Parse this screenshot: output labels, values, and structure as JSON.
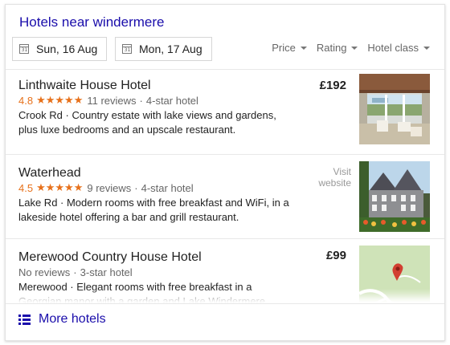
{
  "header": {
    "title": "Hotels near windermere"
  },
  "dates": {
    "checkin": {
      "label": "Sun, 16 Aug",
      "icon": "calendar-icon",
      "day": "31"
    },
    "checkout": {
      "label": "Mon, 17 Aug",
      "icon": "calendar-icon",
      "day": "31"
    }
  },
  "filters": [
    {
      "label": "Price"
    },
    {
      "label": "Rating"
    },
    {
      "label": "Hotel class"
    }
  ],
  "hotels": [
    {
      "name": "Linthwaite House Hotel",
      "rating": "4.8",
      "stars": "★★★★★",
      "reviews": "11 reviews",
      "class": "4-star hotel",
      "desc": "Crook Rd · Country estate with lake views and gardens, plus luxe bedrooms and an upscale restaurant.",
      "price": "£192"
    },
    {
      "name": "Waterhead",
      "rating": "4.5",
      "stars": "★★★★★",
      "reviews": "9 reviews",
      "class": "4-star hotel",
      "desc": "Lake Rd · Modern rooms with free breakfast and WiFi, in a lakeside hotel offering a bar and grill restaurant.",
      "visit_line1": "Visit",
      "visit_line2": "website"
    },
    {
      "name": "Merewood Country House Hotel",
      "reviews": "No reviews",
      "class": "3-star hotel",
      "desc": "Merewood · Elegant rooms with free breakfast in a Georgian manor with a garden and Lake Windermere views.",
      "price": "£99"
    }
  ],
  "more": {
    "label": "More hotels",
    "icon": "list-icon"
  },
  "colors": {
    "link": "#1a0dab",
    "star": "#e7711b",
    "muted": "#666666"
  }
}
